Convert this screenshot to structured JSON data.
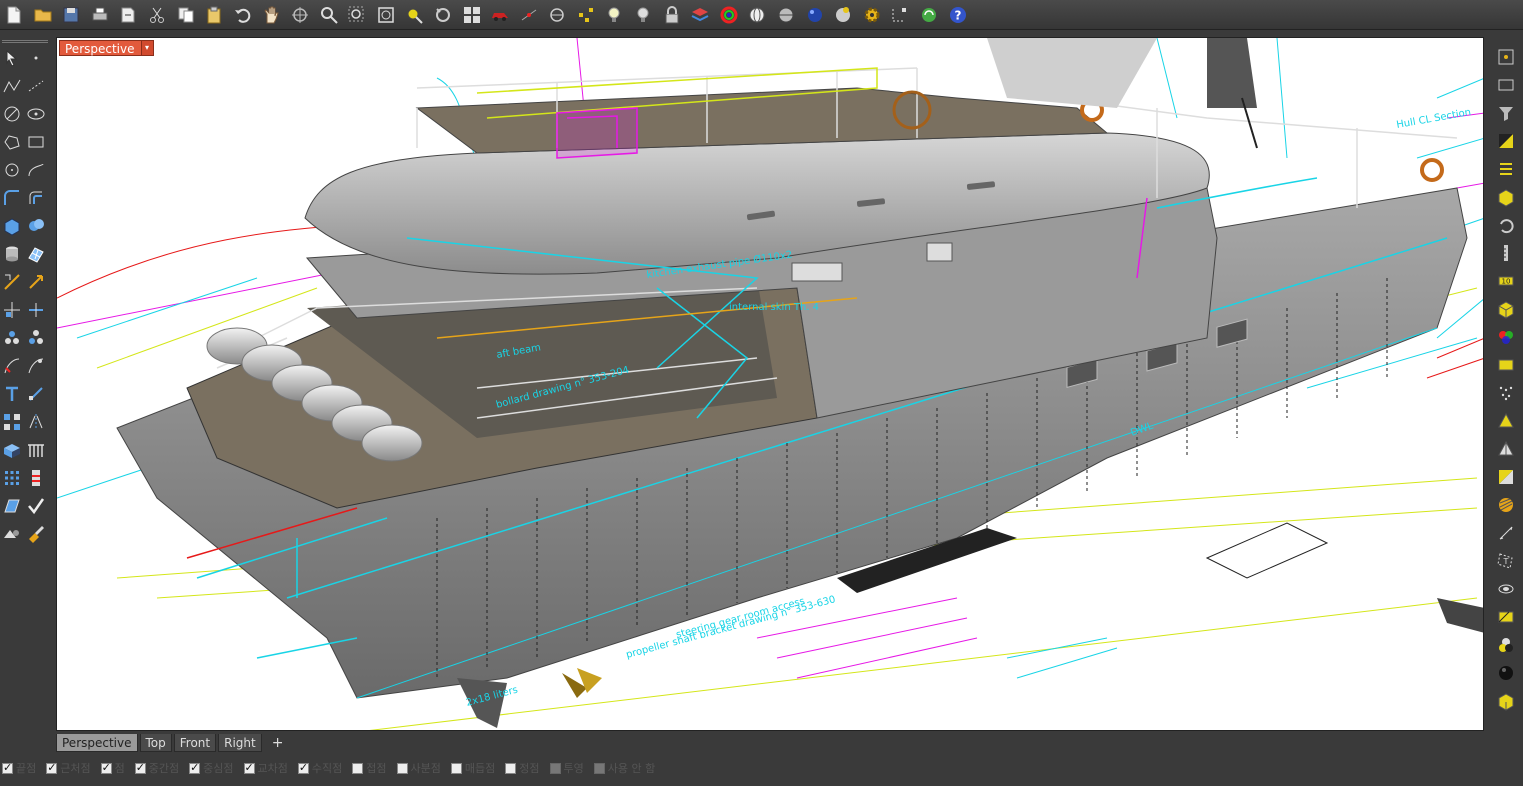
{
  "viewport": {
    "label": "Perspective",
    "caret": "▾"
  },
  "tabs": [
    {
      "label": "Perspective"
    },
    {
      "label": "Top"
    },
    {
      "label": "Front"
    },
    {
      "label": "Right"
    }
  ],
  "tab_add": "+",
  "snaps": [
    {
      "label": "끝점",
      "checked": true
    },
    {
      "label": "근처점",
      "checked": true
    },
    {
      "label": "점",
      "checked": true
    },
    {
      "label": "중간점",
      "checked": true
    },
    {
      "label": "중심점",
      "checked": true
    },
    {
      "label": "교차점",
      "checked": true
    },
    {
      "label": "수직점",
      "checked": true
    },
    {
      "label": "접점",
      "checked": false
    },
    {
      "label": "사분점",
      "checked": false
    },
    {
      "label": "매듭점",
      "checked": false
    },
    {
      "label": "정점",
      "checked": false
    },
    {
      "label": "투영",
      "checked": false
    },
    {
      "label": "사용 안 함",
      "checked": false
    }
  ],
  "drawing_annotations": [
    "internal skin Th. 4",
    "aft beam",
    "bollard drawing n° 353-204",
    "propeller shaft bracket drawing n° 353-630",
    "steering gear room access",
    "DWL",
    "2x18 liters",
    "kitchen exhaust pipe Ø110x2",
    "Hull CL Section"
  ],
  "colors": {
    "hull": "#8c8c8c",
    "deck": "#7a7060",
    "guide_cyan": "#19d4e6",
    "guide_magenta": "#e619e6",
    "guide_yellow": "#d4e619",
    "guide_red": "#e61919",
    "label_bg": "#e25a3c"
  }
}
